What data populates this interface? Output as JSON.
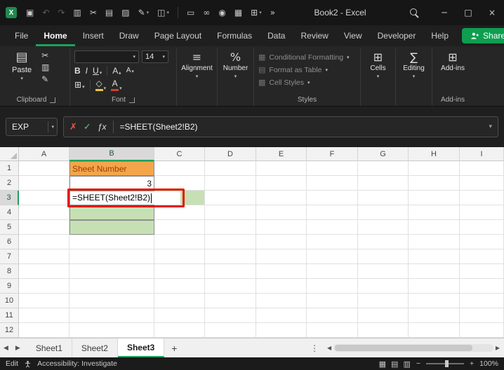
{
  "colors": {
    "accent_green": "#1EA15C",
    "share_green": "#0E9E50",
    "annotation_red": "#E51400",
    "green_fill": "#C6E0B4",
    "orange_fill": "#F4A54B",
    "orange_text": "#9C3E00"
  },
  "icons": {
    "chevron_down": "▾"
  },
  "titlebar": {
    "title": "Book2  -  Excel",
    "logo_letter": "X",
    "icons": [
      {
        "name": "save-icon",
        "glyph": "▣"
      },
      {
        "name": "undo-icon",
        "glyph": "↶",
        "disabled": true
      },
      {
        "name": "redo-icon",
        "glyph": "↷",
        "disabled": true
      },
      {
        "name": "copy-icon",
        "glyph": "▥"
      },
      {
        "name": "cut-icon",
        "glyph": "✂"
      },
      {
        "name": "paste-icon",
        "glyph": "▤"
      },
      {
        "name": "picture-icon",
        "glyph": "▨"
      },
      {
        "name": "format-painter-icon",
        "glyph": "✎",
        "dropdown": true
      },
      {
        "name": "highlight-icon",
        "glyph": "◫",
        "dropdown": true
      },
      {
        "name": "divider",
        "divider": true
      },
      {
        "name": "document-icon",
        "glyph": "▭"
      },
      {
        "name": "link-icon",
        "glyph": "∞"
      },
      {
        "name": "camera-icon",
        "glyph": "◉"
      },
      {
        "name": "table-icon",
        "glyph": "▦"
      },
      {
        "name": "borders-icon",
        "glyph": "⊞",
        "dropdown": true
      },
      {
        "name": "overflow-icon",
        "glyph": "»"
      }
    ],
    "window_controls": {
      "minimize": "─",
      "maximize": "□",
      "close": "×"
    }
  },
  "tabs": {
    "items": [
      "File",
      "Home",
      "Insert",
      "Draw",
      "Page Layout",
      "Formulas",
      "Data",
      "Review",
      "View",
      "Developer",
      "Help"
    ],
    "active": "Home"
  },
  "share": {
    "label": "Share"
  },
  "ribbon": {
    "paste_label": "Paste",
    "font_name": "",
    "font_size": "14",
    "bold": "B",
    "italic": "I",
    "underline": "U",
    "grow_font": "A",
    "shrink_font": "A",
    "icons": {
      "paste": "▤",
      "cut": "✂",
      "copy": "▥",
      "format_painter": "✎",
      "borders": "⊞",
      "fill_color": "◇",
      "font_color": "A",
      "align": "≡",
      "percent": "%",
      "cells": "⊞",
      "editing": "∑",
      "addins": "⊞"
    },
    "alignment_label": "Alignment",
    "number_label": "Number",
    "styles_items": [
      {
        "label": "Conditional Formatting",
        "icon": "conditional-formatting-icon",
        "glyph": "▦"
      },
      {
        "label": "Format as Table",
        "icon": "format-as-table-icon",
        "glyph": "▤"
      },
      {
        "label": "Cell Styles",
        "icon": "cell-styles-icon",
        "glyph": "▩"
      }
    ],
    "cells_label": "Cells",
    "editing_label": "Editing",
    "addins_label": "Add-ins",
    "group_labels": {
      "clipboard": "Clipboard",
      "font": "Font",
      "styles": "Styles",
      "addins": "Add-ins"
    }
  },
  "formula_bar": {
    "name_box": "EXP",
    "cancel": "✗",
    "enter": "✓",
    "fx": "ƒx",
    "formula": "=SHEET(Sheet2!B2)"
  },
  "grid": {
    "columns": [
      "A",
      "B",
      "C",
      "D",
      "E",
      "F",
      "G",
      "H",
      "I"
    ],
    "rows": [
      "1",
      "2",
      "3",
      "4",
      "5",
      "6",
      "7",
      "8",
      "9",
      "10",
      "11",
      "12"
    ],
    "selection": {
      "column": "B",
      "row": "3"
    },
    "cells": [
      {
        "ref": "B1",
        "text": "Sheet Number",
        "bg": "#F4A54B",
        "color": "#9C3E00",
        "bordered": true
      },
      {
        "ref": "B2",
        "text": "3",
        "align": "right",
        "bordered": true
      },
      {
        "ref": "B3",
        "text": "",
        "bordered": true
      },
      {
        "ref": "B4",
        "bg": "#C6E0B4",
        "bordered": true
      },
      {
        "ref": "B5",
        "bg": "#C6E0B4",
        "bordered": true
      },
      {
        "ref": "C3",
        "bg": "#C6E0B4"
      }
    ],
    "edit_cell": {
      "ref": "B3",
      "text": "=SHEET(Sheet2!B2)"
    }
  },
  "sheet_bar": {
    "nav_left": "◀",
    "nav_right": "▶",
    "tabs": [
      "Sheet1",
      "Sheet2",
      "Sheet3"
    ],
    "active": "Sheet3",
    "add_label": "+",
    "menu": "⋮",
    "scroll_left": "◀",
    "scroll_right": "▶"
  },
  "status_bar": {
    "mode": "Edit",
    "accessibility": "Accessibility: Investigate",
    "view_icons": [
      {
        "name": "normal-view-icon",
        "glyph": "▦"
      },
      {
        "name": "page-layout-icon",
        "glyph": "▤"
      },
      {
        "name": "page-break-icon",
        "glyph": "▥"
      }
    ],
    "zoom_out": "−",
    "zoom_in": "+",
    "zoom": "100%"
  }
}
